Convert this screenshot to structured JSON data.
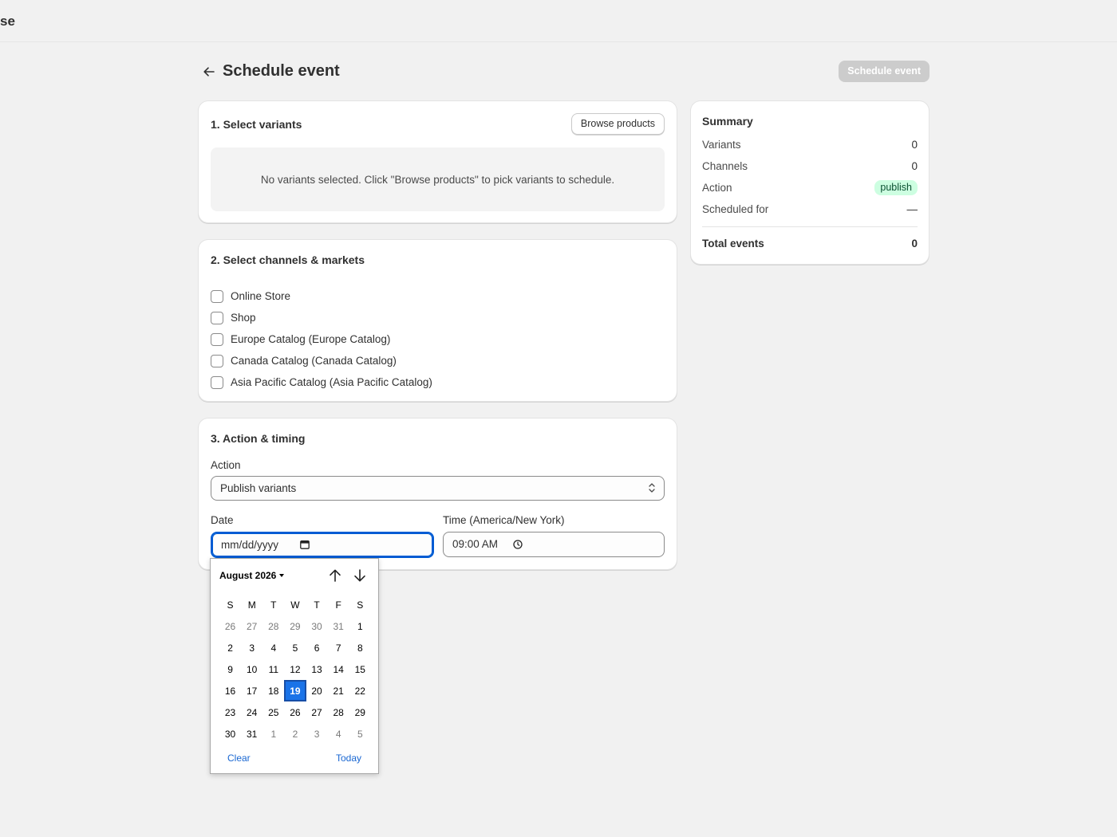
{
  "topbar": {
    "brand": "se"
  },
  "header": {
    "title": "Schedule event",
    "primary_button": "Schedule event"
  },
  "variants_card": {
    "title": "1. Select variants",
    "browse_button": "Browse products",
    "empty_text": "No variants selected. Click \"Browse products\" to pick variants to schedule."
  },
  "channels_card": {
    "title": "2. Select channels & markets",
    "channels": [
      {
        "label": "Online Store",
        "checked": false
      },
      {
        "label": "Shop",
        "checked": false
      },
      {
        "label": "Europe Catalog (Europe Catalog)",
        "checked": false
      },
      {
        "label": "Canada Catalog (Canada Catalog)",
        "checked": false
      },
      {
        "label": "Asia Pacific Catalog (Asia Pacific Catalog)",
        "checked": false
      }
    ]
  },
  "action_card": {
    "title": "3. Action & timing",
    "action_label": "Action",
    "action_value": "Publish variants",
    "date_label": "Date",
    "date_value": "mm/dd/yyyy",
    "time_label": "Time (America/New York)",
    "time_value": "09:00 AM"
  },
  "summary": {
    "title": "Summary",
    "rows": [
      {
        "key": "Variants",
        "value": "0"
      },
      {
        "key": "Channels",
        "value": "0"
      },
      {
        "key": "Action",
        "value": "publish"
      },
      {
        "key": "Scheduled for",
        "value": "—"
      }
    ],
    "total_key": "Total events",
    "total_value": "0"
  },
  "date_picker": {
    "month_label": "August 2026",
    "weekdays": [
      "S",
      "M",
      "T",
      "W",
      "T",
      "F",
      "S"
    ],
    "weeks": [
      [
        {
          "d": "26",
          "m": true
        },
        {
          "d": "27",
          "m": true
        },
        {
          "d": "28",
          "m": true
        },
        {
          "d": "29",
          "m": true
        },
        {
          "d": "30",
          "m": true
        },
        {
          "d": "31",
          "m": true
        },
        {
          "d": "1"
        }
      ],
      [
        {
          "d": "2"
        },
        {
          "d": "3"
        },
        {
          "d": "4"
        },
        {
          "d": "5"
        },
        {
          "d": "6"
        },
        {
          "d": "7"
        },
        {
          "d": "8"
        }
      ],
      [
        {
          "d": "9"
        },
        {
          "d": "10"
        },
        {
          "d": "11"
        },
        {
          "d": "12"
        },
        {
          "d": "13"
        },
        {
          "d": "14"
        },
        {
          "d": "15"
        }
      ],
      [
        {
          "d": "16"
        },
        {
          "d": "17"
        },
        {
          "d": "18"
        },
        {
          "d": "19",
          "s": true
        },
        {
          "d": "20"
        },
        {
          "d": "21"
        },
        {
          "d": "22"
        }
      ],
      [
        {
          "d": "23"
        },
        {
          "d": "24"
        },
        {
          "d": "25"
        },
        {
          "d": "26"
        },
        {
          "d": "27"
        },
        {
          "d": "28"
        },
        {
          "d": "29"
        }
      ],
      [
        {
          "d": "30"
        },
        {
          "d": "31"
        },
        {
          "d": "1",
          "m": true
        },
        {
          "d": "2",
          "m": true
        },
        {
          "d": "3",
          "m": true
        },
        {
          "d": "4",
          "m": true
        },
        {
          "d": "5",
          "m": true
        }
      ]
    ],
    "clear_label": "Clear",
    "today_label": "Today"
  },
  "colors": {
    "accent": "#005bd3",
    "selected_day": "#1a73e8",
    "badge_bg": "#cdfee1",
    "badge_text": "#0c5132",
    "disabled_button": "#cccccc"
  }
}
